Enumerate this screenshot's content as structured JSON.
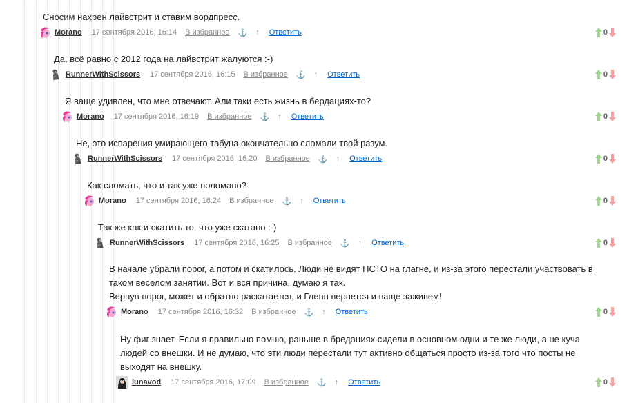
{
  "labels": {
    "favorite": "В избранное",
    "reply": "Ответить",
    "anchor": "⚓",
    "up": "↑"
  },
  "comments": [
    {
      "text": "Сносим нахрен лайвстрит и ставим вордпресс.",
      "author": "Morano",
      "date": "17 сентября 2016, 16:14",
      "avatar": "pony-avatar",
      "votes": "0"
    },
    {
      "text": "Да, всё равно с 2012 года на лайвстрит жалуются :-)",
      "author": "RunnerWithScissors",
      "date": "17 сентября 2016, 16:15",
      "avatar": "runner-avatar",
      "votes": "0"
    },
    {
      "text": "Я ваще удивлен, что мне отвечают. Али таки есть жизнь в бердациях-то?",
      "author": "Morano",
      "date": "17 сентября 2016, 16:19",
      "avatar": "pony-avatar",
      "votes": "0"
    },
    {
      "text": "Не, это испарения умирающего табуна окончательно сломали твой разум.",
      "author": "RunnerWithScissors",
      "date": "17 сентября 2016, 16:20",
      "avatar": "runner-avatar",
      "votes": "0"
    },
    {
      "text": "Как сломать, что и так уже поломано?",
      "author": "Morano",
      "date": "17 сентября 2016, 16:24",
      "avatar": "pony-avatar",
      "votes": "0"
    },
    {
      "text": "Так же как и скатить то, что уже скатано :-)",
      "author": "RunnerWithScissors",
      "date": "17 сентября 2016, 16:25",
      "avatar": "runner-avatar",
      "votes": "0"
    },
    {
      "text": "В начале убрали порог, а потом и скатилось. Люди не видят ПСТО на глагне, и из-за этого перестали участвовать в таком веселом занятии. Вот и вся причина, думаю я так.\nВернув порог, может и обратно раскатается, и Гленн вернется и ваще заживем!",
      "author": "Morano",
      "date": "17 сентября 2016, 16:32",
      "avatar": "pony-avatar",
      "votes": "0"
    },
    {
      "text": "Ну фиг знает. Если я правильно помню, раньше в бредациях сидели в основном одни и те же люди, а не куча людей со внешки. И не думаю, что эти люди перестали тут активно общаться просто из-за того что посты не выходят на внешку.",
      "author": "lunavod",
      "date": "17 сентября 2016, 17:09",
      "avatar": "lunavod-avatar",
      "votes": "0"
    }
  ]
}
